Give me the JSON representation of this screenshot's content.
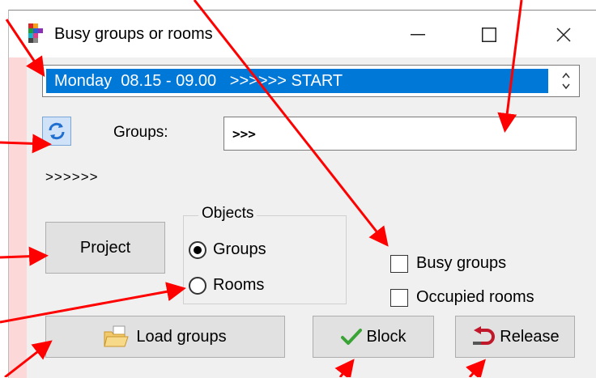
{
  "window": {
    "title": "Busy groups or rooms",
    "minimize_glyph": "—",
    "close_glyph": "✕"
  },
  "time_slot": {
    "selected": "Monday  08.15 - 09.00   >>>>>> START"
  },
  "groups": {
    "label": "Groups:",
    "value": ">>>"
  },
  "status": {
    "text": ">>>>>>"
  },
  "buttons": {
    "project": "Project",
    "load_groups": "Load groups",
    "block": "Block",
    "release": "Release"
  },
  "objects": {
    "legend": "Objects",
    "options": [
      {
        "label": "Groups",
        "selected": true
      },
      {
        "label": "Rooms",
        "selected": false
      }
    ]
  },
  "filters": {
    "busy_groups": {
      "label": "Busy groups",
      "checked": false
    },
    "occupied_rooms": {
      "label": "Occupied rooms",
      "checked": false
    }
  },
  "colors": {
    "selection": "#0078d7",
    "annotation_arrow": "#ff0000",
    "block_check": "#3aa335",
    "release_arrow": "#c0182a"
  },
  "icons": {
    "app": "app-icon",
    "refresh": "refresh-icon",
    "load": "folder-icon",
    "block": "checkmark-icon",
    "release": "undo-arrow-icon"
  }
}
